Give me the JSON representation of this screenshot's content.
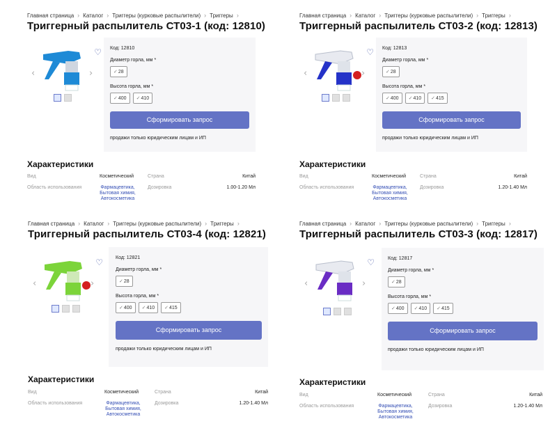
{
  "breadcrumbs": [
    "Главная страница",
    "Каталог",
    "Триггеры (курковые распылители)",
    "Триггеры"
  ],
  "labels": {
    "neck_diameter": "Диаметр горла, мм *",
    "neck_height": "Высота горла, мм *",
    "request_button": "Сформировать запрос",
    "sales_note": "продажи только юридическим лицам и ИП",
    "characteristics": "Характеристики",
    "type": "Вид",
    "country": "Страна",
    "usage_area": "Область использования",
    "dosage": "Дозировка"
  },
  "colors": {
    "button": "#6473c5",
    "link": "#3650b5",
    "heart": "#3b4fa3",
    "panel": "#f6f6f8"
  },
  "cards": [
    {
      "title": "Триггерный распылитель СТ03-1 (код: 12810)",
      "code": "Код: 12810",
      "diameter_options": [
        "28"
      ],
      "height_options": [
        "400",
        "410"
      ],
      "type_value": "Косметический",
      "country_value": "Китай",
      "usage_lines": [
        "Фармацевтика,",
        "Бытовая химия,",
        "Автокосметика"
      ],
      "dosage_value": "1.00-1.20 Мл",
      "accent": "#1e8ad6",
      "head": "#1e8ad6"
    },
    {
      "title": "Триггерный распылитель СТ03-2 (код: 12813)",
      "code": "Код: 12813",
      "diameter_options": [
        "28"
      ],
      "height_options": [
        "400",
        "410",
        "415"
      ],
      "type_value": "Косметический",
      "country_value": "Китай",
      "usage_lines": [
        "Фармацевтика,",
        "Бытовая химия,",
        "Автокосметика"
      ],
      "dosage_value": "1.20-1.40 Мл",
      "accent": "#2432c8",
      "head": "#e8eaf0"
    },
    {
      "title": "Триггерный распылитель СТ03-4 (код: 12821)",
      "code": "Код: 12821",
      "diameter_options": [
        "28"
      ],
      "height_options": [
        "400",
        "410",
        "415"
      ],
      "type_value": "Косметический",
      "country_value": "Китай",
      "usage_lines": [
        "Фармацевтика,",
        "Бытовая химия,",
        "Автокосметика"
      ],
      "dosage_value": "1.20-1.40 Мл",
      "accent": "#7cd43a",
      "head": "#7cd43a"
    },
    {
      "title": "Триггерный распылитель СТ03-3 (код: 12817)",
      "code": "Код: 12817",
      "diameter_options": [
        "28"
      ],
      "height_options": [
        "400",
        "410",
        "415"
      ],
      "type_value": "Косметический",
      "country_value": "Китай",
      "usage_lines": [
        "Фармацевтика,",
        "Бытовая химия,",
        "Автокосметика"
      ],
      "dosage_value": "1.20-1.40 Мл",
      "accent": "#6a2cc4",
      "head": "#e8eaf0"
    }
  ]
}
